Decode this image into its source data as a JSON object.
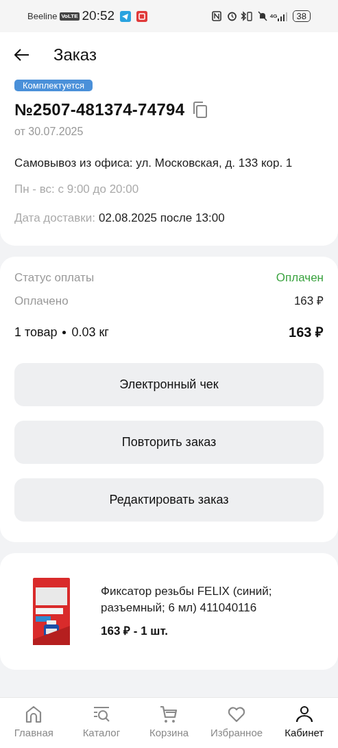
{
  "status_bar": {
    "carrier": "Beeline",
    "network_badge": "VoLTE",
    "time": "20:52",
    "battery": "38",
    "network_type": "4G"
  },
  "header": {
    "title": "Заказ"
  },
  "order": {
    "status": "Комплектуется",
    "number": "№2507-481374-74794",
    "date": "от 30.07.2025",
    "pickup": "Самовывоз из офиса: ул. Московская, д. 133 кор. 1",
    "hours": "Пн - вс: с 9:00 до 20:00",
    "delivery_label": "Дата доставки:",
    "delivery_value": "02.08.2025 после 13:00"
  },
  "payment": {
    "rows": [
      {
        "label": "Статус оплаты",
        "value": "Оплачен",
        "kind": "status"
      },
      {
        "label": "Оплачено",
        "value": "163 ₽",
        "kind": "plain"
      }
    ],
    "items_count": "1 товар",
    "weight": "0.03 кг",
    "total": "163 ₽"
  },
  "actions": [
    "Электронный чек",
    "Повторить заказ",
    "Редактировать заказ"
  ],
  "products": [
    {
      "name": "Фиксатор резьбы FELIX (синий; разъемный; 6 мл) 411040116",
      "price_qty": "163 ₽ - 1 шт."
    }
  ],
  "nav": [
    {
      "label": "Главная",
      "kind": "home",
      "selected": false
    },
    {
      "label": "Каталог",
      "kind": "catalog",
      "selected": false
    },
    {
      "label": "Корзина",
      "kind": "cart",
      "selected": false
    },
    {
      "label": "Избранное",
      "kind": "favorites",
      "selected": false
    },
    {
      "label": "Кабинет",
      "kind": "account",
      "selected": true
    }
  ]
}
